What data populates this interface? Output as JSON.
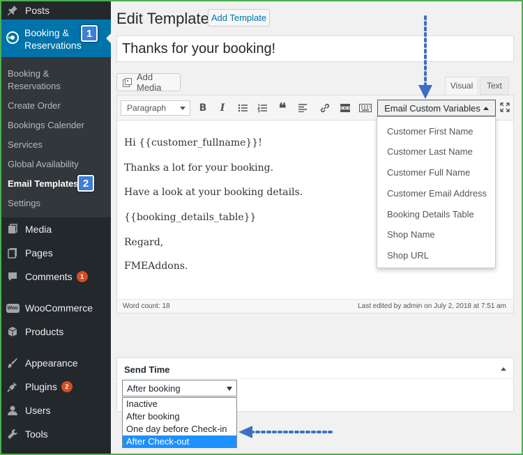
{
  "sidebar": {
    "posts": "Posts",
    "booking_line1": "Booking &",
    "booking_line2": "Reservations",
    "callout1": "1",
    "submenu": [
      "Booking &",
      "Reservations",
      "Create Order",
      "Bookings Calender",
      "Services",
      "Global Availability",
      "Email Templates",
      "Settings"
    ],
    "callout2": "2",
    "media": "Media",
    "pages": "Pages",
    "comments": "Comments",
    "comments_badge": "1",
    "woocommerce": "WooCommerce",
    "woo_icon": "Woo",
    "products": "Products",
    "appearance": "Appearance",
    "plugins": "Plugins",
    "plugins_badge": "2",
    "users": "Users",
    "tools": "Tools"
  },
  "main": {
    "title": "Edit Template",
    "add_template": "Add Template",
    "template_title": "Thanks for your booking!",
    "add_media": "Add Media",
    "tab_visual": "Visual",
    "tab_text": "Text",
    "format_select": "Paragraph",
    "email_vars_button": "Email Custom Variables"
  },
  "email_vars": [
    "Customer First Name",
    "Customer Last Name",
    "Customer Full Name",
    "Customer Email Address",
    "Booking Details Table",
    "Shop Name",
    "Shop URL"
  ],
  "body": [
    "Hi {{customer_fullname}}!",
    "Thanks a lot for your booking.",
    "Have a look at your booking details.",
    "{{booking_details_table}}",
    "Regard,",
    "FMEAddons."
  ],
  "status": {
    "word_count": "Word count: 18",
    "last_edited": "Last edited by admin on July 2, 2018 at 7:51 am"
  },
  "send_time": {
    "heading": "Send Time",
    "selected": "After booking",
    "options": [
      "Inactive",
      "After booking",
      "One day before Check-in",
      "After Check-out"
    ],
    "highlighted_index": 3
  },
  "colors": {
    "accent": "#0073aa",
    "sidebar": "#23282d",
    "highlight": "#1e90ff",
    "callout": "#3b7fd6"
  }
}
